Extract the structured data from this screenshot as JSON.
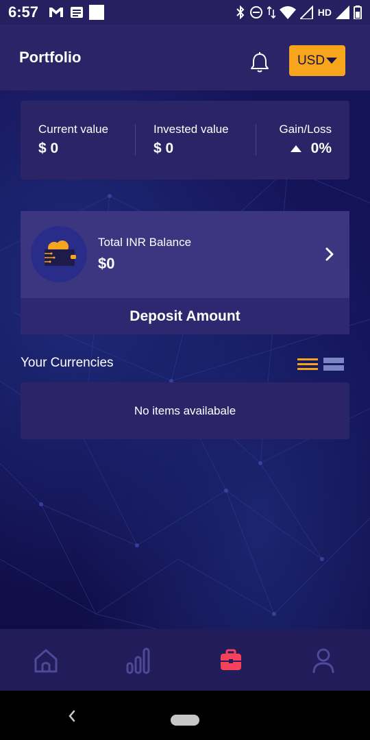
{
  "status_bar": {
    "time": "6:57",
    "network_label": "HD"
  },
  "header": {
    "title": "Portfolio",
    "currency_label": "USD"
  },
  "summary": {
    "current_value_label": "Current value",
    "current_value": "$ 0",
    "invested_value_label": "Invested value",
    "invested_value": "$ 0",
    "gain_loss_label": "Gain/Loss",
    "gain_loss_value": "0%"
  },
  "balance": {
    "label": "Total INR Balance",
    "value": "$0"
  },
  "deposit": {
    "label": "Deposit Amount"
  },
  "currencies": {
    "title": "Your Currencies",
    "empty_text": "No items availabale"
  },
  "bottom_nav": {
    "items": [
      "home-icon",
      "chart-icon",
      "briefcase-icon",
      "profile-icon"
    ],
    "active_index": 2
  },
  "colors": {
    "accent": "#f7a51d",
    "active_nav": "#f5425a",
    "inactive_nav": "#4e4a99"
  }
}
